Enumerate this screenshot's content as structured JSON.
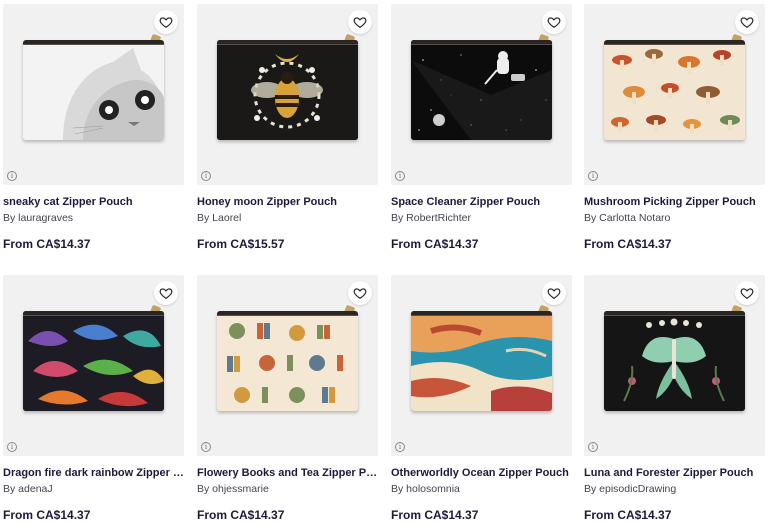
{
  "products": [
    {
      "title": "sneaky cat Zipper Pouch",
      "artist": "By lauragraves",
      "price": "From CA$14.37",
      "art": "cat"
    },
    {
      "title": "Honey moon Zipper Pouch",
      "artist": "By Laorel",
      "price": "From CA$15.57",
      "art": "bee"
    },
    {
      "title": "Space Cleaner Zipper Pouch",
      "artist": "By RobertRichter",
      "price": "From CA$14.37",
      "art": "space"
    },
    {
      "title": "Mushroom Picking Zipper Pouch",
      "artist": "By Carlotta Notaro",
      "price": "From CA$14.37",
      "art": "mushroom"
    },
    {
      "title": "Dragon fire dark rainbow Zipper Po...",
      "artist": "By adenaJ",
      "price": "From CA$14.37",
      "art": "dragon"
    },
    {
      "title": "Flowery Books and Tea Zipper Pou...",
      "artist": "By ohjessmarie",
      "price": "From CA$14.37",
      "art": "books"
    },
    {
      "title": "Otherworldly Ocean Zipper Pouch",
      "artist": "By holosomnia",
      "price": "From CA$14.37",
      "art": "ocean"
    },
    {
      "title": "Luna and Forester Zipper Pouch",
      "artist": "By episodicDrawing",
      "price": "From CA$14.37",
      "art": "luna"
    }
  ],
  "icons": {
    "favorite": "heart-outline-icon",
    "info": "info-icon"
  },
  "colors": {
    "text": "#1c1a3a",
    "card_bg": "#f1f1f1"
  }
}
